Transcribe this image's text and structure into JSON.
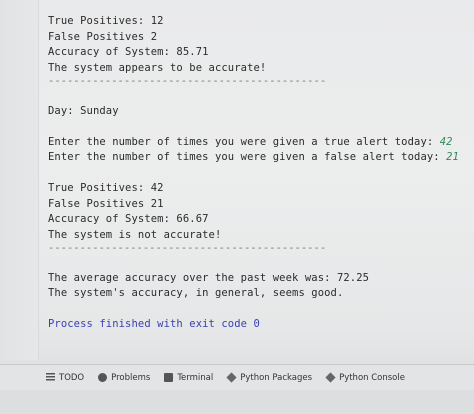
{
  "console": {
    "lines": [
      {
        "type": "text",
        "text": "True Positives: 12"
      },
      {
        "type": "text",
        "text": "False Positives 2"
      },
      {
        "type": "text",
        "text": "Accuracy of System: 85.71"
      },
      {
        "type": "text",
        "text": "The system appears to be accurate!"
      },
      {
        "type": "sep",
        "text": "--------------------------------------------"
      },
      {
        "type": "blank",
        "text": ""
      },
      {
        "type": "text",
        "text": "Day: Sunday"
      },
      {
        "type": "blank",
        "text": ""
      },
      {
        "type": "prompt",
        "text": "Enter the number of times you were given a true alert today: ",
        "value": "42"
      },
      {
        "type": "prompt",
        "text": "Enter the number of times you were given a false alert today: ",
        "value": "21"
      },
      {
        "type": "blank",
        "text": ""
      },
      {
        "type": "text",
        "text": "True Positives: 42"
      },
      {
        "type": "text",
        "text": "False Positives 21"
      },
      {
        "type": "text",
        "text": "Accuracy of System: 66.67"
      },
      {
        "type": "text",
        "text": "The system is not accurate!"
      },
      {
        "type": "sep",
        "text": "--------------------------------------------"
      },
      {
        "type": "blank",
        "text": ""
      },
      {
        "type": "text",
        "text": "The average accuracy over the past week was: 72.25"
      },
      {
        "type": "text",
        "text": "The system's accuracy, in general, seems good."
      },
      {
        "type": "blank",
        "text": ""
      },
      {
        "type": "exit",
        "text": "Process finished with exit code 0"
      }
    ]
  },
  "toolbar": {
    "items": [
      {
        "label": "TODO",
        "icon": "todo-icon"
      },
      {
        "label": "Problems",
        "icon": "problems-icon"
      },
      {
        "label": "Terminal",
        "icon": "terminal-icon"
      },
      {
        "label": "Python Packages",
        "icon": "packages-icon"
      },
      {
        "label": "Python Console",
        "icon": "python-console-icon"
      }
    ]
  },
  "colors": {
    "input": "#2e8b57",
    "exit": "#3a3fb0",
    "text": "#2b2b2b"
  }
}
